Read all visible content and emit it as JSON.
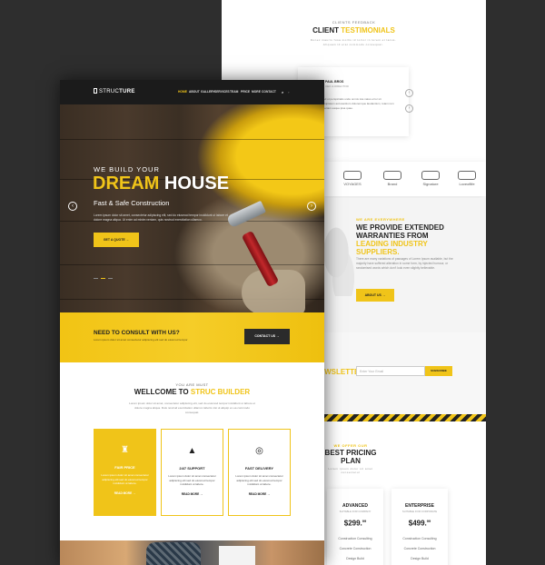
{
  "colors": {
    "accent": "#f0c419",
    "dark": "#1b1b1b",
    "bg": "#2e2e2e"
  },
  "back": {
    "feedback_small": "CLIENTS FEEDBACK",
    "feedback_title_a": "CLIENT",
    "feedback_title_b": "TESTIMONIALS",
    "feedback_text": "Donec mauris fusa mollis id tortor in lorem et lacus. Aliquam id erat commodo consequat.",
    "testimonial": {
      "name": "PAUL BROS",
      "role": "CEO & DIRECTOR",
      "quote": "Sed ut perspiciatis unde omnis iste natus error sit voluptatem accusantium doloremque laudantium, totam rem aperiam eaque ipsa quae."
    },
    "brands": [
      "VOYAGES",
      "Brand",
      "Signature",
      "Loveoflife"
    ],
    "everywhere_small": "WE ARE EVERYWHERE",
    "warranty_a": "WE PROVIDE EXTENDED WARRANTIES FROM ",
    "warranty_b": "LEADING INDUSTRY SUPPLIERS.",
    "warranty_text": "There are many variations of passages of Lorem Ipsum available, but the majority have suffered alteration in some form, by injected humour, or randomised words which don't look even slightly believable.",
    "about_button": "ABOUT US",
    "newsletter_label": "NEWSLETTER",
    "newsletter_placeholder": "Enter Your Email",
    "subscribe_button": "SUBSCRIBE",
    "pricing_small": "WE OFFER OUR",
    "pricing_title": "BEST PRICING PLAN",
    "pricing_text": "Lorem ipsum dolor sit amet consectetur",
    "plans": [
      {
        "name": "ADVANCED",
        "sub": "SUITABLE FOR COMPANY",
        "price": "$299.",
        "cents": "99",
        "features": [
          "Construction Consulting",
          "Concrete Construction",
          "Design Build"
        ]
      },
      {
        "name": "ENTERPRISE",
        "sub": "SUITABLE FOR CORPORATE",
        "price": "$499.",
        "cents": "99",
        "features": [
          "Construction Consulting",
          "Concrete Construction",
          "Design Build"
        ]
      }
    ]
  },
  "front": {
    "logo_a": "STRUC",
    "logo_b": "TURE",
    "nav": [
      "HOME",
      "ABOUT",
      "GALLERY",
      "SERVICES",
      "TEAM",
      "PRICE",
      "MORE",
      "CONTACT"
    ],
    "hero_sub": "WE BUILD YOUR",
    "hero_main_a": "DREAM",
    "hero_main_b": "HOUSE",
    "hero_tag": "Fast & Safe Construction",
    "hero_text": "Lorem ipsum dolor sit amet, consectetur adipiscing elit, sed do eiusmod tempor incididunt ut labore et dolore magna aliqua. Ut enim ad minim veniam, quis nostrud exercitation ullamco.",
    "quote_button": "GET A QUOTE",
    "consult_title": "NEED TO CONSULT WITH US?",
    "consult_sub": "Lorem ipsum dolor sit amet consectetur adipiscing elit sed do eiusmod tempor",
    "contact_button": "CONTACT US",
    "welcome_small": "YOU ARE MUST",
    "welcome_a": "WELLCOME TO ",
    "welcome_b": "STRUC BUILDER",
    "welcome_text": "Lorem ipsum dolor sit amet, consectetur adipiscing elit, sed do eiusmod tempor incididunt ut labore et dolore magna aliqua. Duis nostrud exercitation ullamco laboris nisi ut aliquip ex ea commodo consequat.",
    "features": [
      {
        "icon": "money-bag-icon",
        "title": "FAIR PRICE",
        "text": "Lorem ipsum dolor sit amet consectetur adipiscing elit sed do eiusmod tempor incididunt ut labore.",
        "link": "READ MORE"
      },
      {
        "icon": "rocket-icon",
        "title": "24/7 SUPPORT",
        "text": "Lorem ipsum dolor sit amet consectetur adipiscing elit sed do eiusmod tempor incididunt ut labore.",
        "link": "READ MORE"
      },
      {
        "icon": "delivery-icon",
        "title": "FAST DELIVERY",
        "text": "Lorem ipsum dolor sit amet consectetur adipiscing elit sed do eiusmod tempor incididunt ut labore.",
        "link": "READ MORE"
      }
    ]
  }
}
